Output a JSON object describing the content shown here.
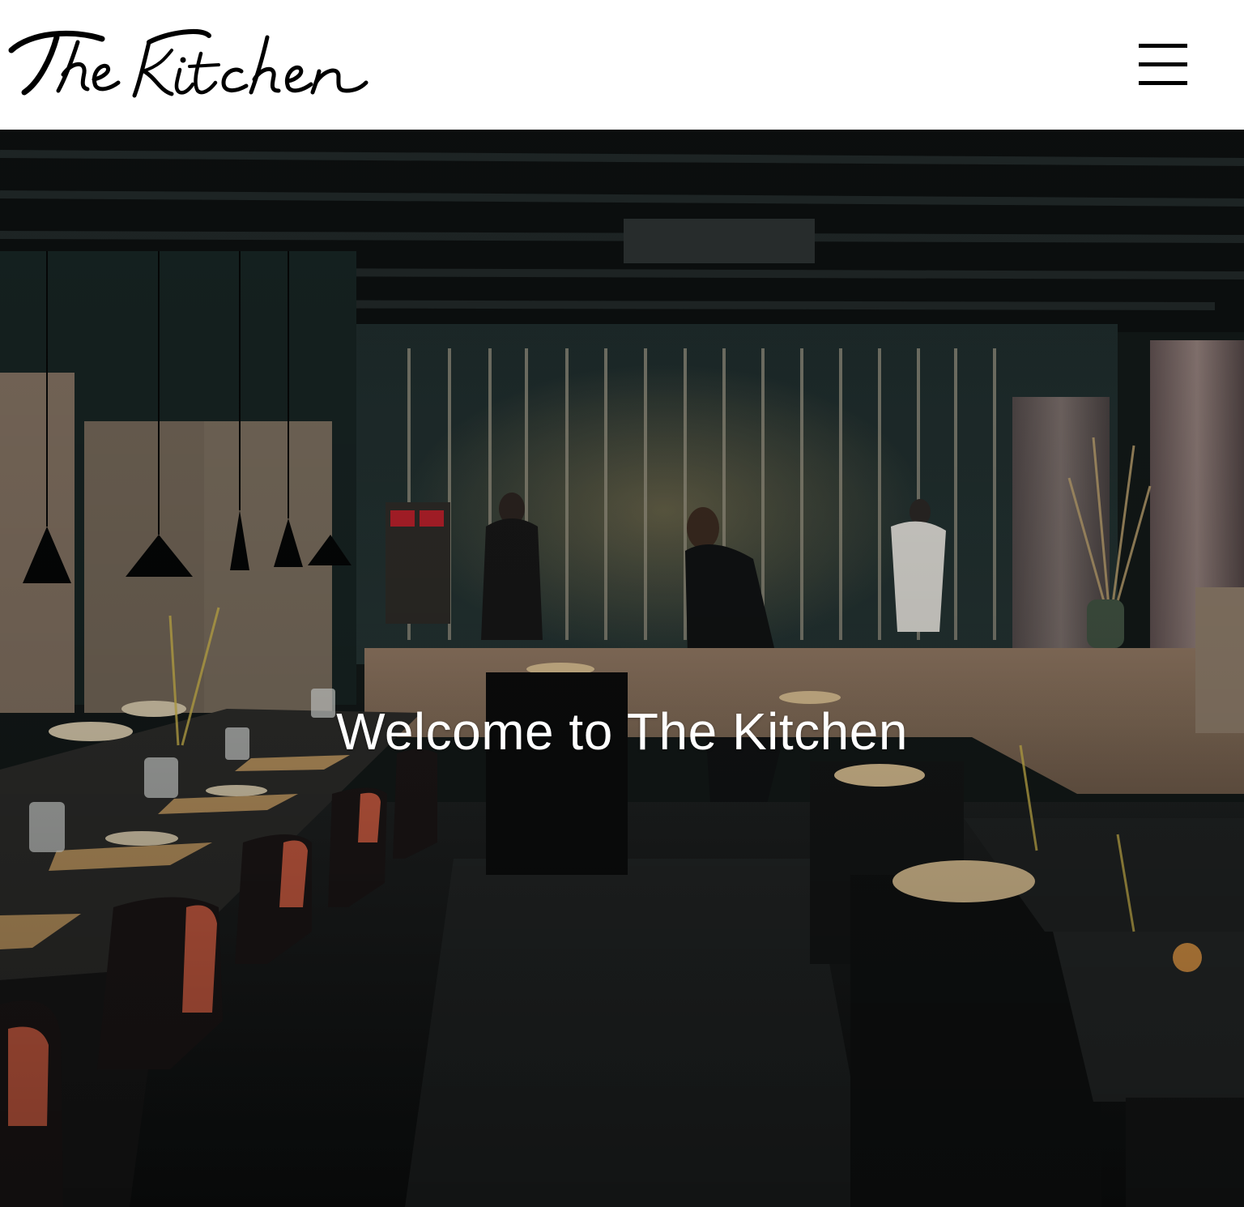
{
  "header": {
    "logo_text": "The Kitchen",
    "menu_icon": "hamburger-menu-icon"
  },
  "hero": {
    "title": "Welcome to The Kitchen",
    "image": "restaurant-dining-room-photo"
  },
  "colors": {
    "header_background": "#ffffff",
    "logo_ink": "#000000",
    "hero_title": "#ffffff"
  }
}
